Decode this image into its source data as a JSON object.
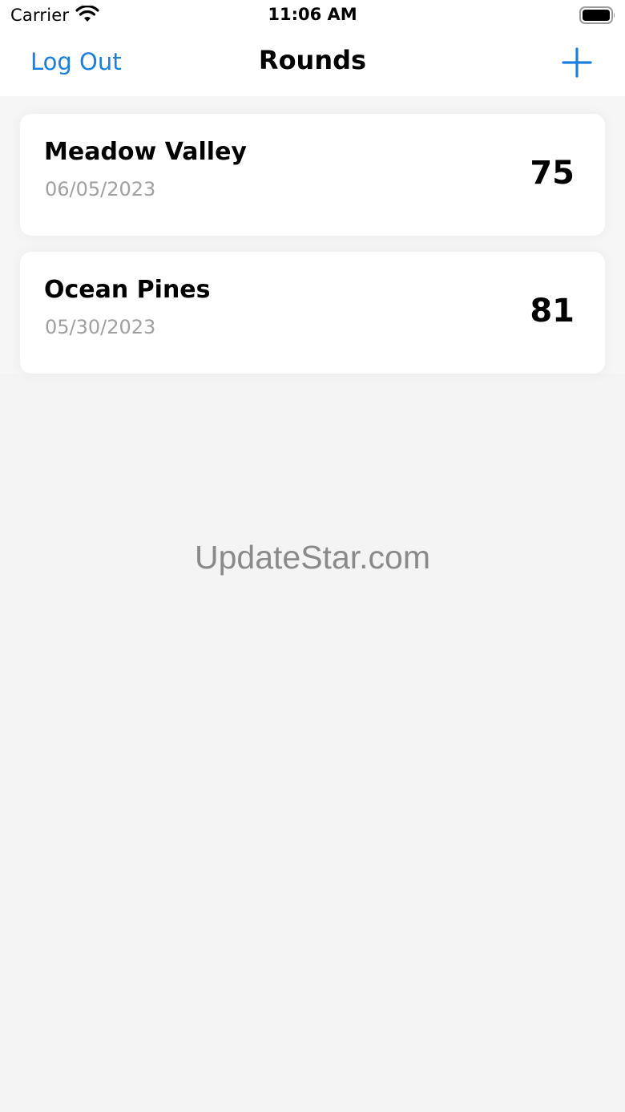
{
  "status_bar": {
    "carrier": "Carrier",
    "time": "11:06 AM"
  },
  "nav": {
    "logout_label": "Log Out",
    "title": "Rounds",
    "add_icon": "plus-icon"
  },
  "rounds": [
    {
      "course": "Meadow Valley",
      "date": "06/05/2023",
      "score": "75"
    },
    {
      "course": "Ocean Pines",
      "date": "05/30/2023",
      "score": "81"
    }
  ],
  "watermark": "UpdateStar.com",
  "colors": {
    "accent": "#1a7fe0",
    "background": "#f4f4f4",
    "card": "#ffffff",
    "secondary_text": "#a0a0a0"
  }
}
